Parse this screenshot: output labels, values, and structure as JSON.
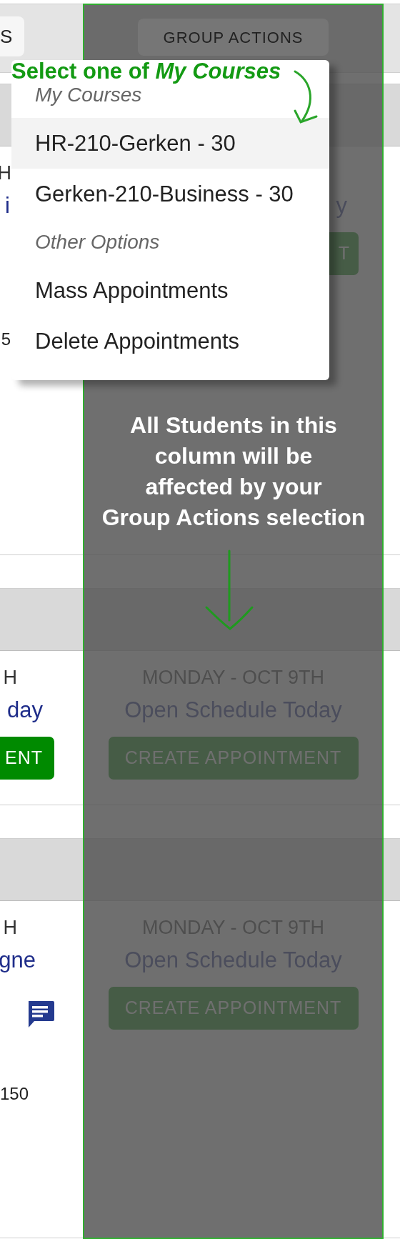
{
  "header": {
    "left_button": "S",
    "group_actions_button": "GROUP ACTIONS"
  },
  "rows": [
    {
      "left": {
        "date": "H",
        "link": "i",
        "note": "5"
      },
      "middle": {
        "link": "y",
        "button": "T"
      }
    },
    {
      "left": {
        "date": "H",
        "link": "day",
        "button": "ENT"
      },
      "middle": {
        "date": "MONDAY - OCT 9TH",
        "link": "Open Schedule Today",
        "button": "CREATE APPOINTMENT"
      }
    },
    {
      "left": {
        "date": "H",
        "link": "gne",
        "message_icon": true,
        "note": "150"
      },
      "middle": {
        "date": "MONDAY - OCT 9TH",
        "link": "Open Schedule Today",
        "button": "CREATE APPOINTMENT"
      }
    }
  ],
  "dropdown": {
    "groups": [
      {
        "header": "My Courses",
        "items": [
          {
            "label": "HR-210-Gerken - 30",
            "selected": true
          },
          {
            "label": "Gerken-210-Business - 30",
            "selected": false
          }
        ]
      },
      {
        "header": "Other Options",
        "items": [
          {
            "label": "Mass Appointments",
            "selected": false
          },
          {
            "label": "Delete Appointments",
            "selected": false
          }
        ]
      }
    ]
  },
  "annotations": {
    "menu_hint": "Select one of *My Courses*",
    "column_hint": "All Students in this\ncolumn will be\naffected by your\nGroup Actions selection"
  }
}
